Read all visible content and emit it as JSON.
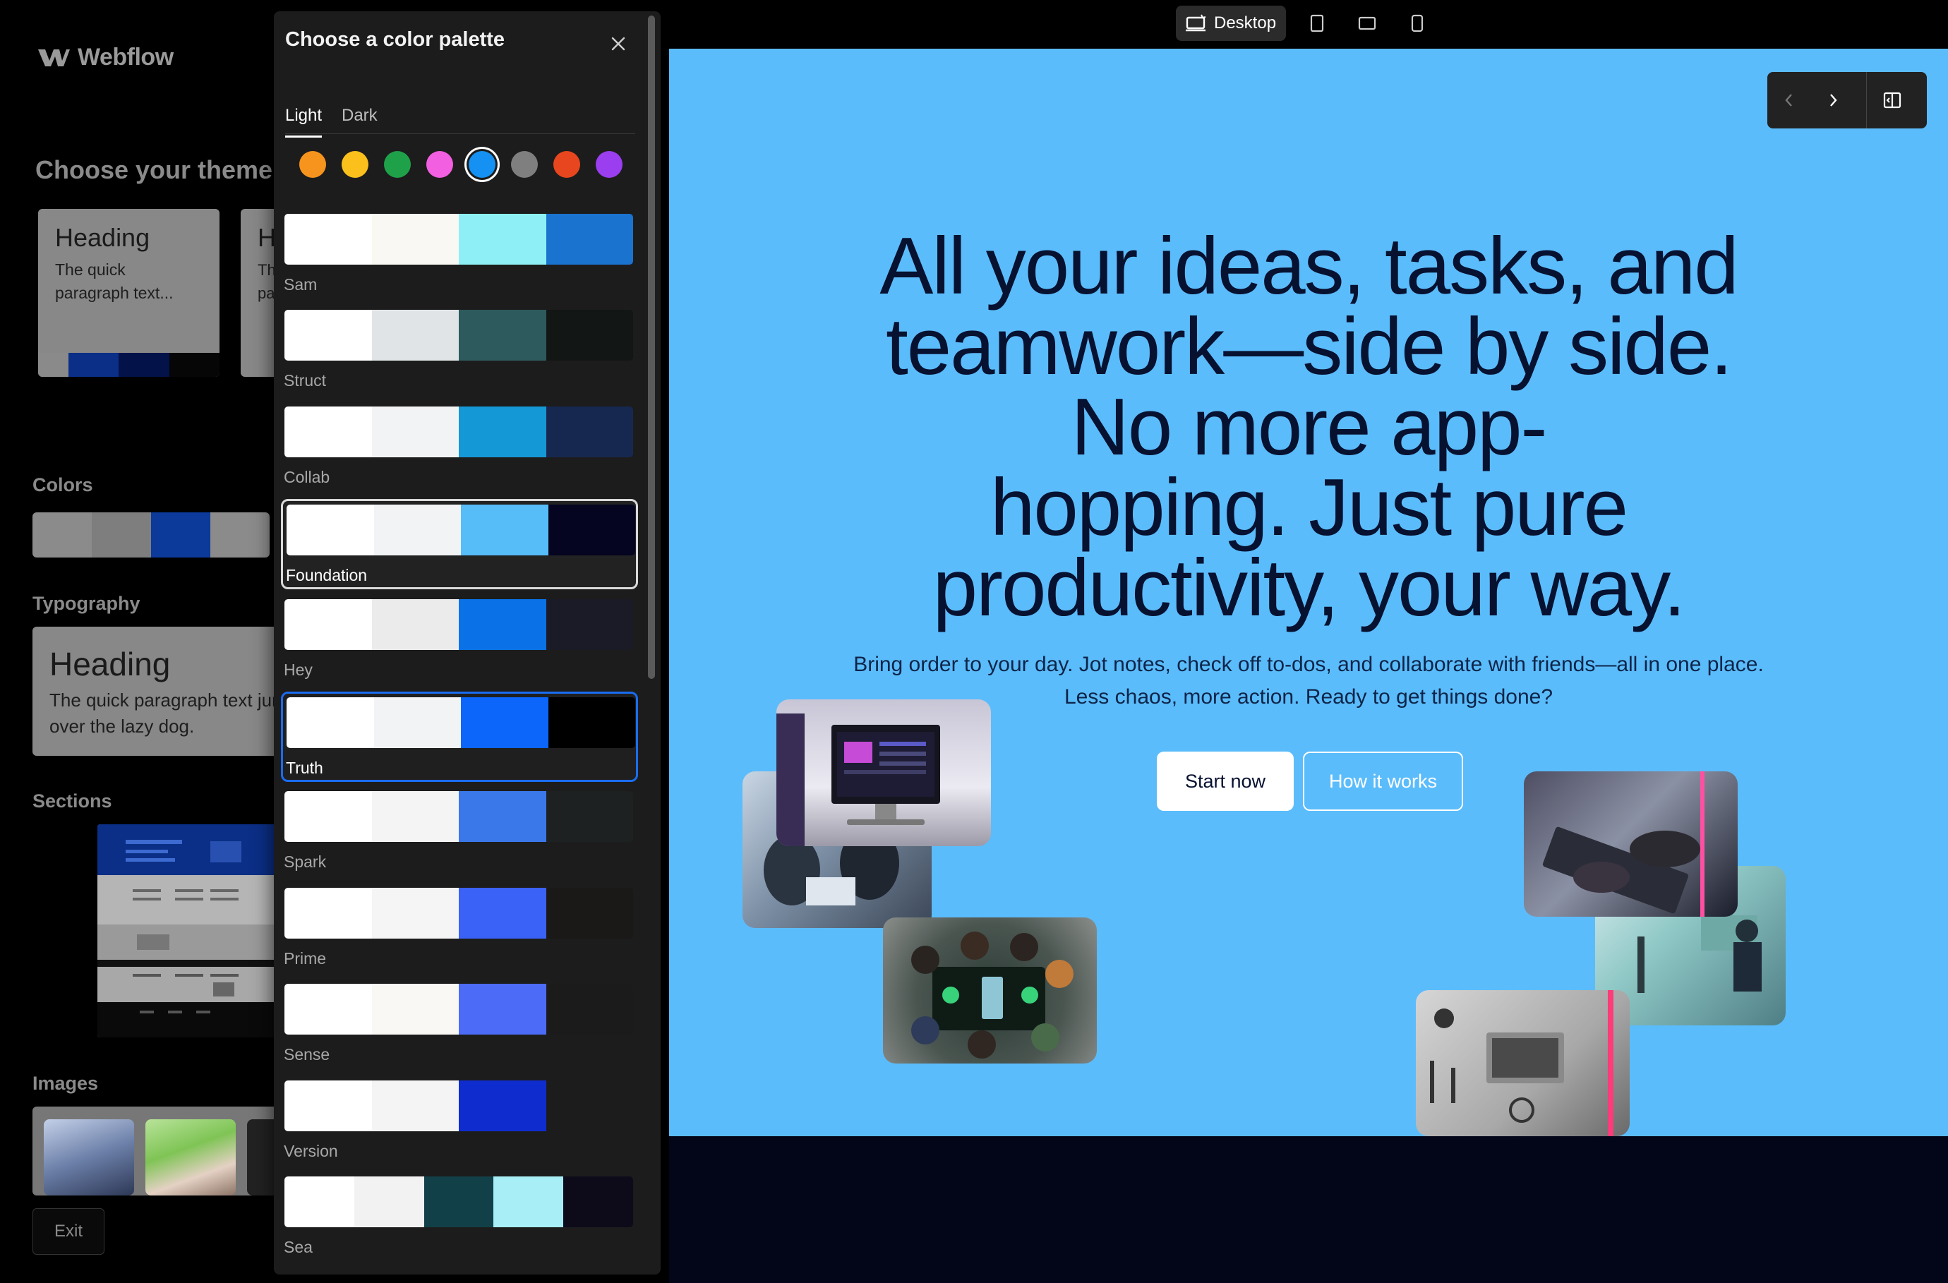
{
  "app": {
    "logo_text": "Webflow"
  },
  "theme_panel": {
    "title": "Choose your theme",
    "theme_card_1": {
      "heading": "Heading",
      "paragraph": "The quick paragraph text...",
      "swatches": [
        "#8a8a8a",
        "#0b2f86",
        "#04124a",
        "#060606"
      ]
    },
    "theme_card_2": {
      "heading": "H",
      "paragraph": "Th pa"
    },
    "colors_label": "Colors",
    "colors_swatches": [
      "#8b8b8b",
      "#7e7e7e",
      "#0b3a9a",
      "#8b8b8b"
    ],
    "typography_label": "Typography",
    "typography_heading": "Heading",
    "typography_paragraph": "The quick paragraph text jumps over the lazy dog.",
    "sections_label": "Sections",
    "images_label": "Images",
    "exit_label": "Exit"
  },
  "palette_modal": {
    "title": "Choose a color palette",
    "tabs": [
      {
        "label": "Light",
        "active": true
      },
      {
        "label": "Dark",
        "active": false
      }
    ],
    "hue_dots": [
      {
        "name": "orange",
        "color": "#f7941d"
      },
      {
        "name": "yellow",
        "color": "#fbc01b"
      },
      {
        "name": "green",
        "color": "#1fa14a"
      },
      {
        "name": "pink",
        "color": "#f25fe0"
      },
      {
        "name": "blue",
        "color": "#1491f2",
        "selected": true
      },
      {
        "name": "gray",
        "color": "#7f7f7f"
      },
      {
        "name": "red",
        "color": "#e8461e"
      },
      {
        "name": "purple",
        "color": "#9a3ef0"
      }
    ],
    "palettes": [
      {
        "name": "Sam",
        "colors": [
          "#ffffff",
          "#faf8f2",
          "#8ef0f6",
          "#1a73cf"
        ]
      },
      {
        "name": "Struct",
        "colors": [
          "#ffffff",
          "#e0e4e6",
          "#2d5a5d",
          "#121615"
        ]
      },
      {
        "name": "Collab",
        "colors": [
          "#ffffff",
          "#f2f3f4",
          "#1598d6",
          "#172850"
        ]
      },
      {
        "name": "Foundation",
        "colors": [
          "#ffffff",
          "#f2f3f5",
          "#56bdf8",
          "#050521"
        ],
        "highlighted": true
      },
      {
        "name": "Hey",
        "colors": [
          "#ffffff",
          "#ebebeb",
          "#0a72e6",
          "#1a1b27"
        ]
      },
      {
        "name": "Truth",
        "colors": [
          "#ffffff",
          "#f2f3f5",
          "#0c66fa",
          "#000000"
        ],
        "selected": true
      },
      {
        "name": "Spark",
        "colors": [
          "#ffffff",
          "#f3f4f3",
          "#3a78ea",
          "#1d2122"
        ]
      },
      {
        "name": "Prime",
        "colors": [
          "#ffffff",
          "#f5f5f5",
          "#3b62f6",
          "#1b1818"
        ]
      },
      {
        "name": "Sense",
        "colors": [
          "#ffffff",
          "#f9f8f4",
          "#4c6bf7",
          "#1b1b1b"
        ]
      },
      {
        "name": "Version",
        "colors": [
          "#ffffff",
          "#f4f4f4",
          "#0f2dcf",
          "#1c1c1c"
        ]
      },
      {
        "name": "Sea",
        "colors": [
          "#ffffff",
          "#f2f2f2",
          "#124048",
          "#a8eef6",
          "#0d0b1a"
        ]
      }
    ]
  },
  "preview": {
    "device_modes": [
      {
        "name": "desktop",
        "label": "Desktop",
        "active": true
      },
      {
        "name": "tablet",
        "label": ""
      },
      {
        "name": "tablet-landscape",
        "label": ""
      },
      {
        "name": "mobile",
        "label": ""
      }
    ],
    "hero": {
      "title_lines": [
        "All your ideas, tasks, and",
        "teamwork—side by side.",
        "No more app-",
        "hopping. Just pure",
        "productivity, your way."
      ],
      "subtitle_lines": [
        "Bring order to your day. Jot notes, check off to-dos, and collaborate with friends—all in one place.",
        "Less chaos, more action. Ready to get things done?"
      ],
      "primary_cta": "Start now",
      "secondary_cta": "How it works"
    },
    "canvas_color": "#5bbcfb"
  }
}
